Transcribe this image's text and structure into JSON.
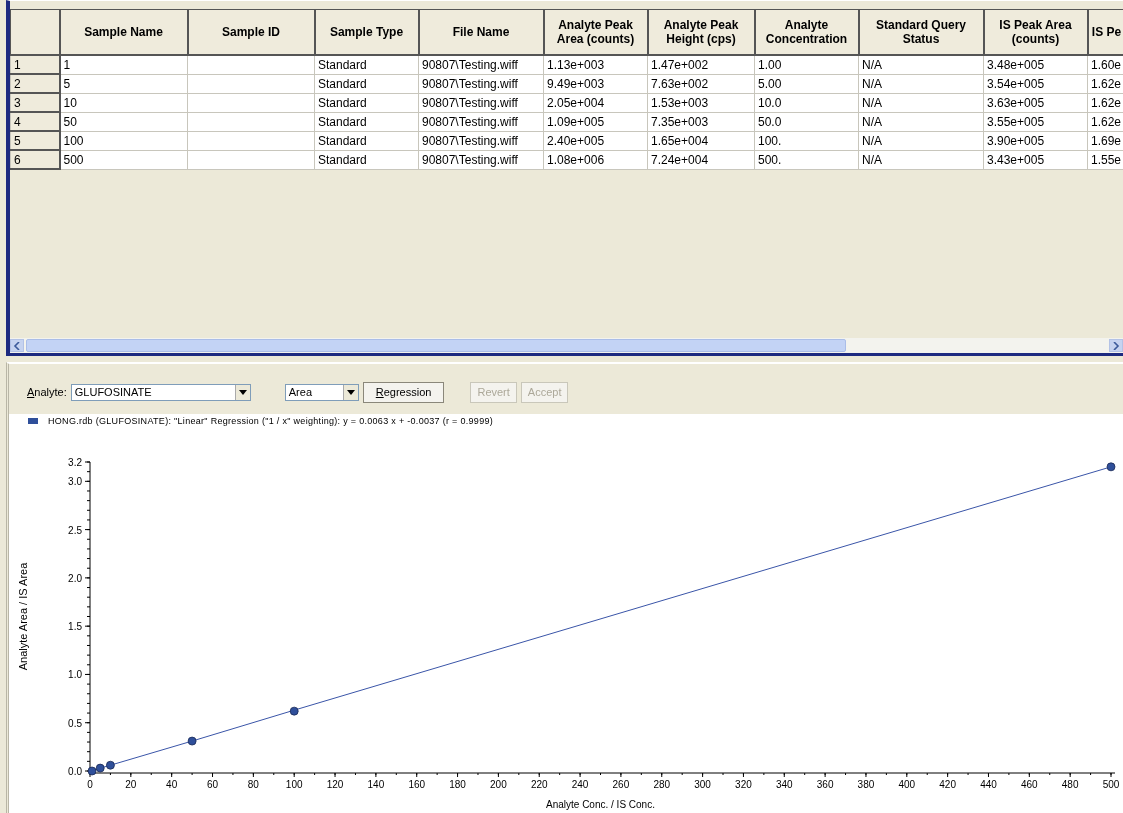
{
  "table": {
    "columns": [
      {
        "label": "Sample Name"
      },
      {
        "label": "Sample ID"
      },
      {
        "label": "Sample Type"
      },
      {
        "label": "File Name"
      },
      {
        "label": "Analyte Peak Area (counts)"
      },
      {
        "label": "Analyte Peak Height (cps)"
      },
      {
        "label": "Analyte Concentration"
      },
      {
        "label": "Standard Query Status"
      },
      {
        "label": "IS Peak Area (counts)"
      },
      {
        "label": "IS Pe"
      }
    ],
    "rows": [
      {
        "number": "1",
        "cells": [
          "1",
          null,
          "Standard",
          "90807\\Testing.wiff",
          "1.13e+003",
          "1.47e+002",
          "1.00",
          "N/A",
          "3.48e+005",
          "1.60e"
        ]
      },
      {
        "number": "2",
        "cells": [
          "5",
          null,
          "Standard",
          "90807\\Testing.wiff",
          "9.49e+003",
          "7.63e+002",
          "5.00",
          "N/A",
          "3.54e+005",
          "1.62e"
        ]
      },
      {
        "number": "3",
        "cells": [
          "10",
          null,
          "Standard",
          "90807\\Testing.wiff",
          "2.05e+004",
          "1.53e+003",
          "10.0",
          "N/A",
          "3.63e+005",
          "1.62e"
        ]
      },
      {
        "number": "4",
        "cells": [
          "50",
          null,
          "Standard",
          "90807\\Testing.wiff",
          "1.09e+005",
          "7.35e+003",
          "50.0",
          "N/A",
          "3.55e+005",
          "1.62e"
        ]
      },
      {
        "number": "5",
        "cells": [
          "100",
          null,
          "Standard",
          "90807\\Testing.wiff",
          "2.40e+005",
          "1.65e+004",
          "100.",
          "N/A",
          "3.90e+005",
          "1.69e"
        ]
      },
      {
        "number": "6",
        "cells": [
          "500",
          null,
          "Standard",
          "90807\\Testing.wiff",
          "1.08e+006",
          "7.24e+004",
          "500.",
          "N/A",
          "3.43e+005",
          "1.55e"
        ]
      }
    ]
  },
  "controls": {
    "analyte_label": "Analyte:",
    "analyte_value": "GLUFOSINATE",
    "mode_value": "Area",
    "buttons": [
      {
        "label": "Regression",
        "disabled": false
      },
      {
        "label": "Revert",
        "disabled": true
      },
      {
        "label": "Accept",
        "disabled": true
      }
    ]
  },
  "chart_data": {
    "type": "scatter",
    "xlabel": "Analyte Conc. / IS Conc.",
    "ylabel": "Analyte Area / IS Area",
    "x": [
      0,
      1,
      5,
      10,
      50,
      100,
      500
    ],
    "series": [
      {
        "name": "HONG.rdb (GLUFOSINATE): \"Linear\" Regression (\"1 / x\" weighting): y = 0.0063 x + -0.0037 (r = 0.9999)",
        "color": "#2f4f9a",
        "values": [
          null,
          0.0,
          0.03,
          0.06,
          0.31,
          0.62,
          3.15
        ]
      },
      {
        "type": "line",
        "color": "#3a55a8",
        "values": [
          0.0,
          0.0,
          0.03,
          0.06,
          0.31,
          0.63,
          3.15
        ]
      }
    ],
    "xlim": [
      0,
      500
    ],
    "ylim": [
      0,
      3.2
    ],
    "xticks": [
      0,
      20,
      40,
      60,
      80,
      100,
      120,
      140,
      160,
      180,
      200,
      220,
      240,
      260,
      280,
      300,
      320,
      340,
      360,
      380,
      400,
      420,
      440,
      460,
      480,
      500
    ],
    "yticks": [
      {
        "value": 0,
        "label": "0.0"
      },
      {
        "value": 0.5,
        "label": "0.5"
      },
      {
        "value": 1,
        "label": "1.0"
      },
      {
        "value": 1.5,
        "label": "1.5"
      },
      {
        "value": 2,
        "label": "2.0"
      },
      {
        "value": 2.5,
        "label": "2.5"
      },
      {
        "value": 3,
        "label": "3.0"
      },
      {
        "value": 3.2,
        "label": "3.2"
      }
    ]
  }
}
